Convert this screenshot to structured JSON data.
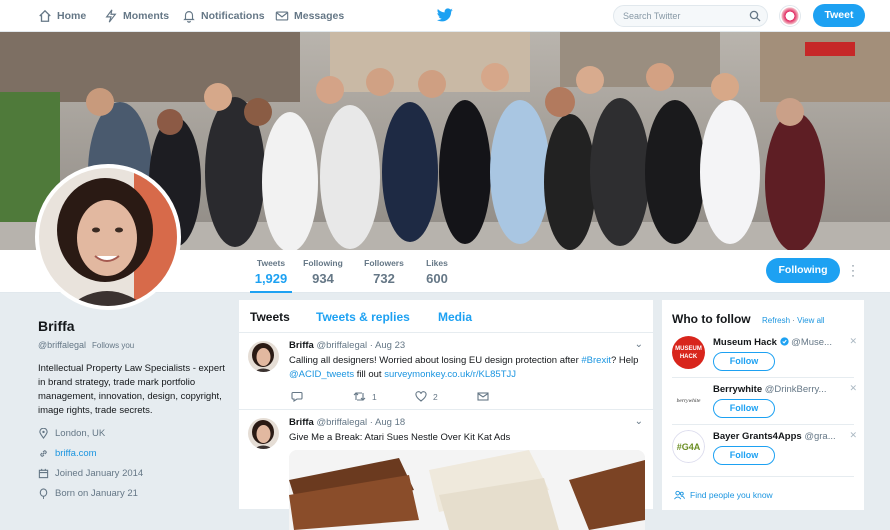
{
  "nav": {
    "home": "Home",
    "moments": "Moments",
    "notifications": "Notifications",
    "messages": "Messages",
    "search_placeholder": "Search Twitter",
    "tweet_button": "Tweet"
  },
  "stats": [
    {
      "label": "Tweets",
      "value": "1,929"
    },
    {
      "label": "Following",
      "value": "934"
    },
    {
      "label": "Followers",
      "value": "732"
    },
    {
      "label": "Likes",
      "value": "600"
    }
  ],
  "follow_button": "Following",
  "profile": {
    "name": "Briffa",
    "handle": "@briffalegal",
    "follows_you": "Follows you",
    "bio": "Intellectual Property Law Specialists - expert in brand strategy, trade mark portfolio management, innovation, design, copyright, image rights, trade secrets.",
    "location": "London, UK",
    "website": "briffa.com",
    "joined": "Joined January 2014",
    "born": "Born on January 21"
  },
  "tabs": [
    "Tweets",
    "Tweets & replies",
    "Media"
  ],
  "tweets": [
    {
      "name": "Briffa",
      "handle": "@briffalegal",
      "date": "· Aug 23",
      "text_a": "Calling all designers! Worried about losing EU design protection after ",
      "hashtag": "#Brexit",
      "text_b": "? Help ",
      "mention": "@ACID_tweets",
      "text_c": " fill out ",
      "link": "surveymonkey.co.uk/r/KL85TJJ",
      "retweets": "1",
      "likes": "2"
    },
    {
      "name": "Briffa",
      "handle": "@briffalegal",
      "date": "· Aug 18",
      "text": "Give Me a Break: Atari Sues Nestle Over Kit Kat Ads"
    }
  ],
  "who_to_follow": {
    "title": "Who to follow",
    "refresh": "Refresh",
    "dot": "·",
    "view_all": "View all",
    "items": [
      {
        "name": "Museum Hack",
        "handle": "@Muse...",
        "button": "Follow",
        "avatar_text": "MUSEUM HACK"
      },
      {
        "name": "Berrywhite",
        "handle": "@DrinkBerry...",
        "button": "Follow",
        "avatar_text": "berrywhite"
      },
      {
        "name": "Bayer Grants4Apps",
        "handle": "@gra...",
        "button": "Follow",
        "avatar_text": "#G4A"
      }
    ],
    "find_people": "Find people you know"
  },
  "colors": {
    "accent": "#1da1f2",
    "link": "#1b95e0",
    "muted": "#657786"
  }
}
